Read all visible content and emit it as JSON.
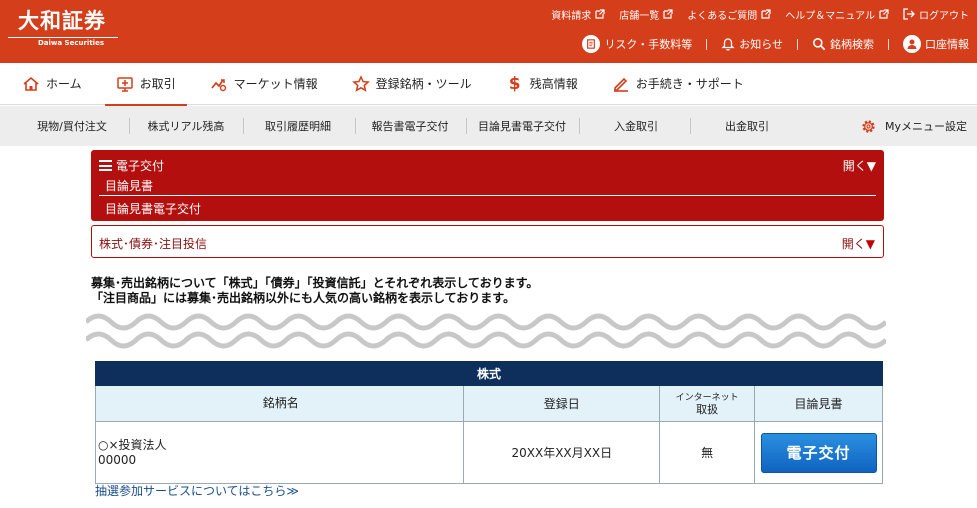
{
  "brand": {
    "logo_main": "大和証券",
    "logo_sub": "Daiwa Securities"
  },
  "header": {
    "top_links": [
      {
        "label": "資料請求",
        "icon": "external-link-icon"
      },
      {
        "label": "店舗一覧",
        "icon": "external-link-icon"
      },
      {
        "label": "よくあるご質問",
        "icon": "external-link-icon"
      },
      {
        "label": "ヘルプ＆マニュアル",
        "icon": "external-link-icon"
      },
      {
        "label": "ログアウト",
        "icon": "logout-icon"
      }
    ],
    "sub_links": [
      {
        "label": "リスク・手数料等",
        "icon": "document-icon"
      },
      {
        "label": "お知らせ",
        "icon": "bell-icon"
      },
      {
        "label": "銘柄検索",
        "icon": "search-icon"
      },
      {
        "label": "口座情報",
        "icon": "user-icon"
      }
    ]
  },
  "main_nav": {
    "items": [
      {
        "label": "ホーム",
        "icon": "home-icon"
      },
      {
        "label": "お取引",
        "icon": "trade-icon",
        "active": true
      },
      {
        "label": "マーケット情報",
        "icon": "chart-icon"
      },
      {
        "label": "登録銘柄・ツール",
        "icon": "star-icon"
      },
      {
        "label": "残高情報",
        "icon": "dollar-icon"
      },
      {
        "label": "お手続き・サポート",
        "icon": "pencil-icon"
      }
    ]
  },
  "sub_nav": {
    "items": [
      "現物/買付注文",
      "株式リアル残高",
      "取引履歴明細",
      "報告書電子交付",
      "目論見書電子交付",
      "入金取引",
      "出金取引"
    ],
    "my_menu": "Myメニュー設定"
  },
  "panel_main": {
    "title": "電子交付",
    "open_label": "開く▼",
    "line1": "目論見書",
    "line2": "目論見書電子交付"
  },
  "panel_section": {
    "label": "株式･債券･注目投信",
    "open_label": "開く",
    "open_arrow": "▼"
  },
  "notice": {
    "line1": "募集･売出銘柄について「株式」「債券」「投資信託」とそれぞれ表示しております。",
    "line2": "「注目商品」には募集･売出銘柄以外にも人気の高い銘柄を表示しております。"
  },
  "table": {
    "caption": "株式",
    "headers": {
      "name": "銘柄名",
      "date": "登録日",
      "net_top": "インターネット",
      "net_bottom": "取扱",
      "doc": "目論見書"
    },
    "rows": [
      {
        "name": "○×投資法人",
        "code": "00000",
        "date": "20XX年XX月XX日",
        "net": "無",
        "button": "電子交付"
      }
    ]
  },
  "lottery_link": "抽選参加サービスについてはこちら≫",
  "colors": {
    "brand_red": "#d43e1b",
    "panel_red": "#b40f0f",
    "navy": "#0e2f5c",
    "header_cell": "#e3f2f9",
    "button_blue": "#1a78d4"
  }
}
